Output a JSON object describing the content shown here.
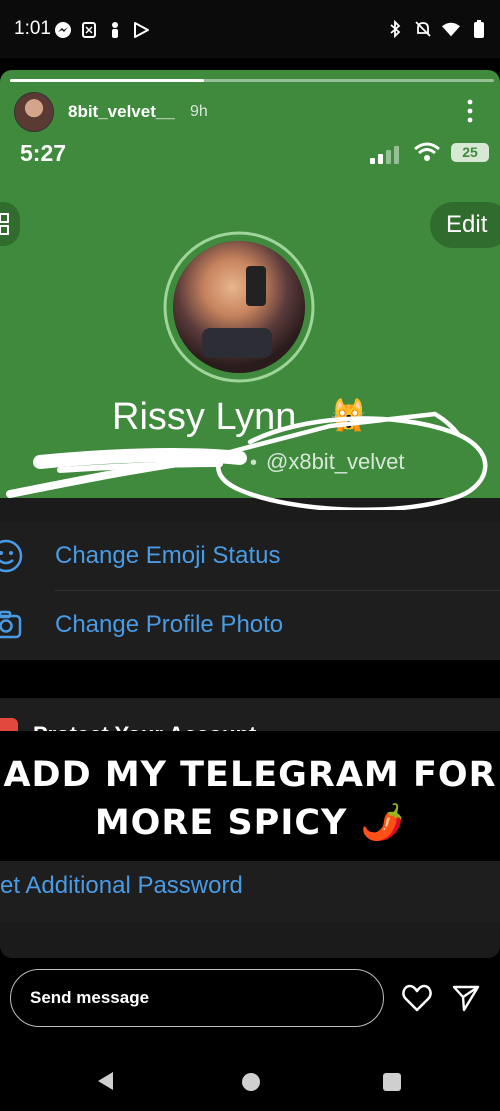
{
  "status_bar": {
    "time": "1:01"
  },
  "story": {
    "username": "8bit_velvet__",
    "age": "9h",
    "progress_fraction": 0.4
  },
  "screenshot": {
    "time": "5:27",
    "battery": "25",
    "edit_label": "Edit",
    "name": "Rissy Lynn",
    "name_emoji": "🙀",
    "handle_prefix": "•",
    "handle": "@x8bit_velvet",
    "rows": [
      {
        "label": "Change Emoji Status",
        "icon": "smiley-icon"
      },
      {
        "label": "Change Profile Photo",
        "icon": "camera-icon"
      }
    ],
    "security_title": "Protect Your Account",
    "additional_password": "et Additional Password"
  },
  "banner": {
    "line1": "ADD MY TELEGRAM FOR",
    "line2": "MORE SPICY 🌶️"
  },
  "composer": {
    "placeholder": "Send message"
  },
  "colors": {
    "story_green": "#3f8a3d",
    "link_blue": "#4a9be6"
  }
}
